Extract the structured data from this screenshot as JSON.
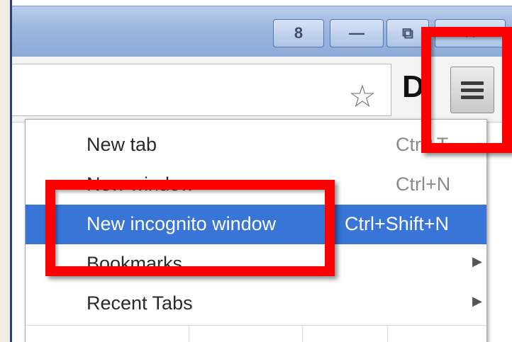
{
  "window": {
    "caption_buttons": [
      {
        "icon": "user-icon",
        "glyph": "8"
      },
      {
        "icon": "minimize-icon",
        "glyph": "—"
      },
      {
        "icon": "restore-icon",
        "glyph": "⧉"
      },
      {
        "icon": "close-icon",
        "glyph": "✕"
      }
    ]
  },
  "toolbar": {
    "star_glyph": "☆",
    "extension_letter": "D"
  },
  "menu": {
    "items": [
      {
        "label": "New tab",
        "shortcut": "Ctrl+T"
      },
      {
        "label": "New window",
        "shortcut": "Ctrl+N"
      },
      {
        "label": "New incognito window",
        "shortcut": "Ctrl+Shift+N"
      },
      {
        "label": "Bookmarks",
        "shortcut": ""
      },
      {
        "label": "Recent Tabs",
        "shortcut": ""
      }
    ],
    "highlight_color": "#3875d7"
  },
  "annotations": {
    "box_color": "#ff0000"
  }
}
